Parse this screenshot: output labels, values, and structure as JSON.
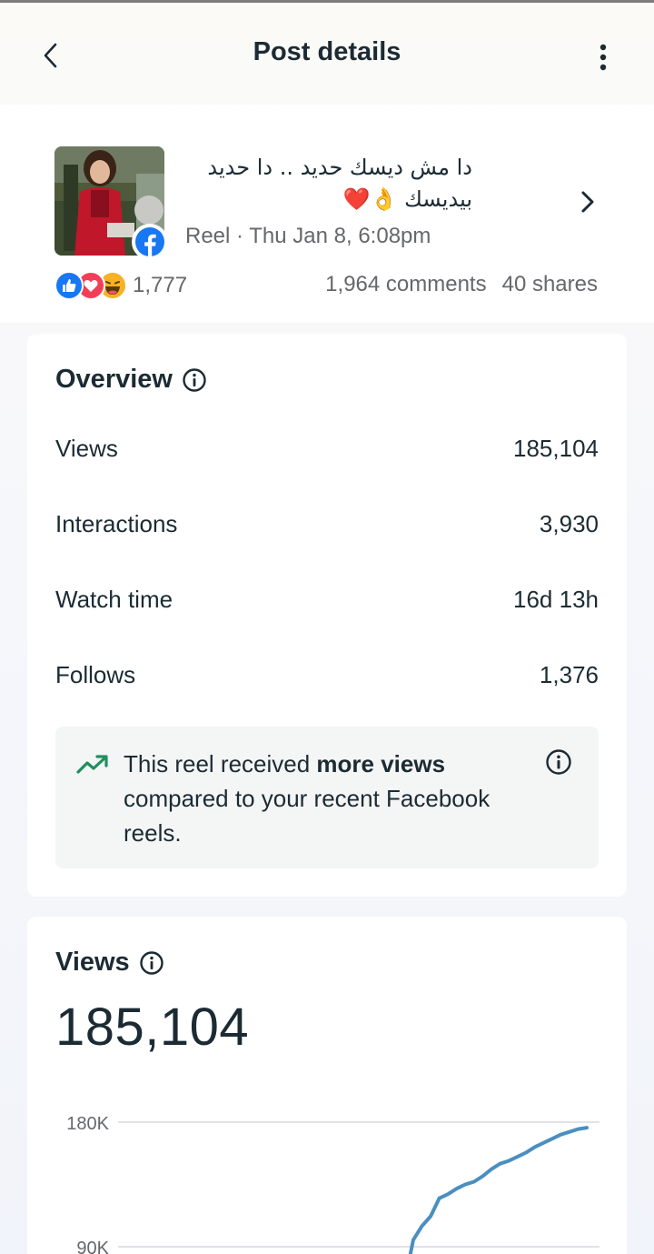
{
  "header": {
    "title": "Post details"
  },
  "post": {
    "caption_line1": "دا مش ديسك حديد .. دا حديد",
    "caption_line2": "بيديسك 👌❤️",
    "meta": "Reel · Thu Jan 8, 6:08pm",
    "reactions": [
      "like-icon",
      "love-icon",
      "haha-icon"
    ],
    "reaction_count": "1,777",
    "comments": "1,964 comments",
    "shares": "40 shares"
  },
  "overview": {
    "title": "Overview",
    "metrics": [
      {
        "label": "Views",
        "value": "185,104"
      },
      {
        "label": "Interactions",
        "value": "3,930"
      },
      {
        "label": "Watch time",
        "value": "16d 13h"
      },
      {
        "label": "Follows",
        "value": "1,376"
      }
    ],
    "insight": {
      "prefix": "This reel received ",
      "bold": "more views",
      "suffix": " compared to your recent Facebook reels."
    }
  },
  "views_card": {
    "title": "Views",
    "total": "185,104"
  },
  "chart_data": {
    "type": "line",
    "y_ticks": [
      "180K",
      "90K"
    ],
    "series": [
      {
        "values": [
          95000,
          105000,
          112000,
          125000,
          128000,
          132000,
          135000,
          137000,
          141000,
          146000,
          150000,
          152000,
          155000,
          158000,
          162000,
          165000,
          168000,
          171000,
          173000,
          175000,
          176000
        ]
      }
    ],
    "color": "#4a8fc0"
  },
  "colors": {
    "accent_blue": "#1877f2",
    "trend_green": "#1f8f5f"
  }
}
